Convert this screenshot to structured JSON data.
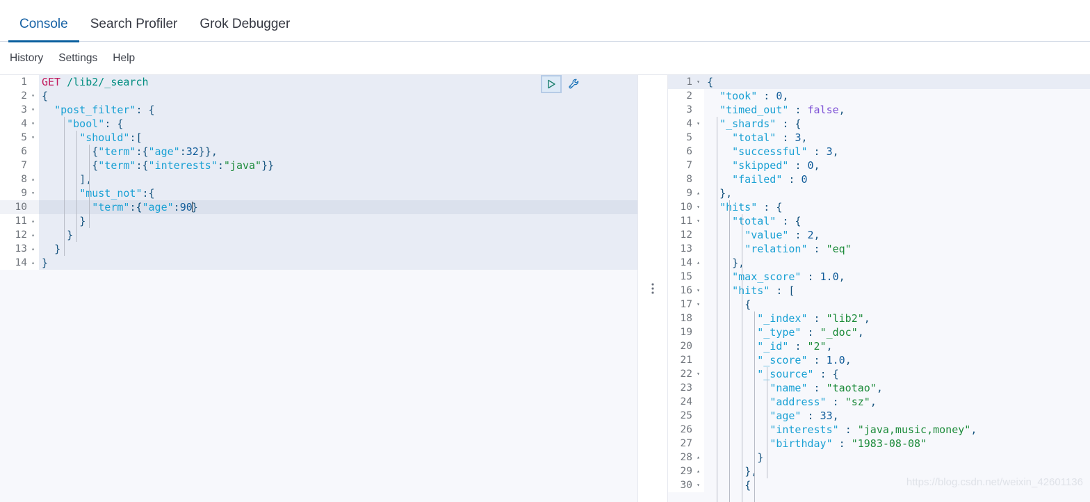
{
  "tabs": [
    {
      "label": "Console",
      "active": true
    },
    {
      "label": "Search Profiler",
      "active": false
    },
    {
      "label": "Grok Debugger",
      "active": false
    }
  ],
  "submenu": [
    {
      "label": "History"
    },
    {
      "label": "Settings"
    },
    {
      "label": "Help"
    }
  ],
  "actions": {
    "run_icon": "play-icon",
    "run_title": "Click to send request",
    "wrench_icon": "wrench-icon",
    "wrench_title": "Open documentation"
  },
  "splitter": {
    "icon": "drag-handle-icon"
  },
  "editor": {
    "request_method": "GET",
    "request_path": "/lib2/_search",
    "current_line": 10,
    "total_lines": 14,
    "lines": [
      {
        "n": 1,
        "fold": "",
        "text": "GET /lib2/_search"
      },
      {
        "n": 2,
        "fold": "▾",
        "text": "{"
      },
      {
        "n": 3,
        "fold": "▾",
        "text": "  \"post_filter\": {"
      },
      {
        "n": 4,
        "fold": "▾",
        "text": "    \"bool\": {"
      },
      {
        "n": 5,
        "fold": "▾",
        "text": "      \"should\":["
      },
      {
        "n": 6,
        "fold": "",
        "text": "        {\"term\":{\"age\":32}},"
      },
      {
        "n": 7,
        "fold": "",
        "text": "        {\"term\":{\"interests\":\"java\"}}"
      },
      {
        "n": 8,
        "fold": "▴",
        "text": "      ],"
      },
      {
        "n": 9,
        "fold": "▾",
        "text": "      \"must_not\":{"
      },
      {
        "n": 10,
        "fold": "",
        "text": "        \"term\":{\"age\":90}"
      },
      {
        "n": 11,
        "fold": "▴",
        "text": "      }"
      },
      {
        "n": 12,
        "fold": "▴",
        "text": "    }"
      },
      {
        "n": 13,
        "fold": "▴",
        "text": "  }"
      },
      {
        "n": 14,
        "fold": "▴",
        "text": "}"
      }
    ]
  },
  "response": {
    "current_line": 1,
    "lines": [
      {
        "n": 1,
        "fold": "▾",
        "text": "{"
      },
      {
        "n": 2,
        "fold": "",
        "text": "  \"took\" : 0,"
      },
      {
        "n": 3,
        "fold": "",
        "text": "  \"timed_out\" : false,"
      },
      {
        "n": 4,
        "fold": "▾",
        "text": "  \"_shards\" : {"
      },
      {
        "n": 5,
        "fold": "",
        "text": "    \"total\" : 3,"
      },
      {
        "n": 6,
        "fold": "",
        "text": "    \"successful\" : 3,"
      },
      {
        "n": 7,
        "fold": "",
        "text": "    \"skipped\" : 0,"
      },
      {
        "n": 8,
        "fold": "",
        "text": "    \"failed\" : 0"
      },
      {
        "n": 9,
        "fold": "▴",
        "text": "  },"
      },
      {
        "n": 10,
        "fold": "▾",
        "text": "  \"hits\" : {"
      },
      {
        "n": 11,
        "fold": "▾",
        "text": "    \"total\" : {"
      },
      {
        "n": 12,
        "fold": "",
        "text": "      \"value\" : 2,"
      },
      {
        "n": 13,
        "fold": "",
        "text": "      \"relation\" : \"eq\""
      },
      {
        "n": 14,
        "fold": "▴",
        "text": "    },"
      },
      {
        "n": 15,
        "fold": "",
        "text": "    \"max_score\" : 1.0,"
      },
      {
        "n": 16,
        "fold": "▾",
        "text": "    \"hits\" : ["
      },
      {
        "n": 17,
        "fold": "▾",
        "text": "      {"
      },
      {
        "n": 18,
        "fold": "",
        "text": "        \"_index\" : \"lib2\","
      },
      {
        "n": 19,
        "fold": "",
        "text": "        \"_type\" : \"_doc\","
      },
      {
        "n": 20,
        "fold": "",
        "text": "        \"_id\" : \"2\","
      },
      {
        "n": 21,
        "fold": "",
        "text": "        \"_score\" : 1.0,"
      },
      {
        "n": 22,
        "fold": "▾",
        "text": "        \"_source\" : {"
      },
      {
        "n": 23,
        "fold": "",
        "text": "          \"name\" : \"taotao\","
      },
      {
        "n": 24,
        "fold": "",
        "text": "          \"address\" : \"sz\","
      },
      {
        "n": 25,
        "fold": "",
        "text": "          \"age\" : 33,"
      },
      {
        "n": 26,
        "fold": "",
        "text": "          \"interests\" : \"java,music,money\","
      },
      {
        "n": 27,
        "fold": "",
        "text": "          \"birthday\" : \"1983-08-08\""
      },
      {
        "n": 28,
        "fold": "▴",
        "text": "        }"
      },
      {
        "n": 29,
        "fold": "▴",
        "text": "      },"
      },
      {
        "n": 30,
        "fold": "▾",
        "text": "      {"
      }
    ]
  },
  "watermark": "https://blog.csdn.net/weixin_42601136",
  "colors": {
    "accent": "#0a5f9e",
    "active_tab_text": "#1762a5",
    "method": "#c2185b",
    "url": "#008d7f",
    "key": "#1ba1d4",
    "string": "#1c8b3a",
    "number": "#0f5b99",
    "boolean": "#7f53d6",
    "request_block_bg": "#e8ecf5",
    "current_line_bg": "#dbe1ed",
    "pane_bg": "#f7f8fc"
  }
}
